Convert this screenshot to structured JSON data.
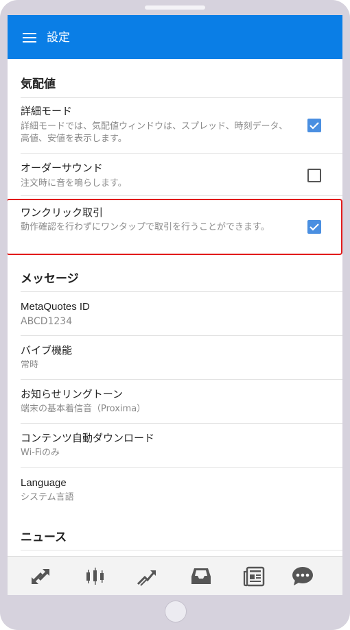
{
  "app": {
    "title": "設定"
  },
  "sections": {
    "quotes": {
      "header": "気配値"
    },
    "messages": {
      "header": "メッセージ"
    },
    "news": {
      "header": "ニュース"
    }
  },
  "settings": {
    "detail_mode": {
      "title": "詳細モード",
      "subtitle": "詳細モードでは、気配値ウィンドウは、スプレッド、時刻データ、高値、安値を表示します。",
      "checked": true
    },
    "order_sound": {
      "title": "オーダーサウンド",
      "subtitle": "注文時に音を鳴らします。",
      "checked": false
    },
    "one_click": {
      "title": "ワンクリック取引",
      "subtitle": "動作確認を行わずにワンタップで取引を行うことができます。",
      "checked": true
    },
    "metaquotes_id": {
      "title": "MetaQuotes ID",
      "value": "ABCD1234"
    },
    "vibration": {
      "title": "バイブ機能",
      "value": "常時"
    },
    "ringtone": {
      "title": "お知らせリングトーン",
      "value": "端末の基本着信音（Proxima）"
    },
    "auto_download": {
      "title": "コンテンツ自動ダウンロード",
      "value": "Wi-Fiのみ"
    },
    "language": {
      "title": "Language",
      "value": "システム言語"
    }
  },
  "bottom_nav": [
    "quotes-icon",
    "chart-candles-icon",
    "trade-icon",
    "inbox-icon",
    "news-icon",
    "chat-icon"
  ],
  "colors": {
    "appbar": "#0a7ee6",
    "checkbox": "#4a8fe1",
    "highlight": "#e21a1a",
    "icon": "#555555"
  }
}
